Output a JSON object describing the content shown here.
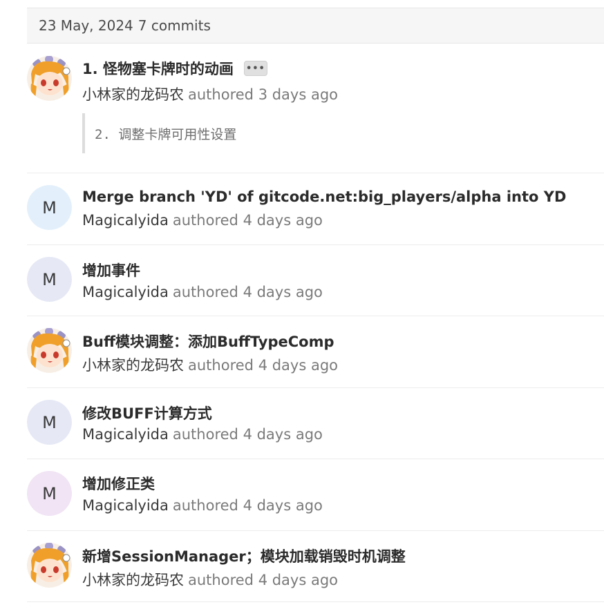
{
  "day_group": {
    "date": "23 May, 2024",
    "count_label": "7 commits"
  },
  "colors": {
    "header_bg": "#f6f6f6",
    "avatar_blue": "#e3f0fb",
    "avatar_indigo": "#e6e9f5",
    "avatar_purple": "#f1e4f4"
  },
  "commits": [
    {
      "title": "1. 怪物塞卡牌时的动画",
      "author": "小林家的龙码农",
      "authored_label": "authored",
      "time": "3 days ago",
      "avatar": "anime-avatar",
      "ellipsis": "•••",
      "description": "2. 调整卡牌可用性设置"
    },
    {
      "title": "Merge branch 'YD' of gitcode.net:big_players/alpha into YD",
      "author": "Magicalyida",
      "authored_label": "authored",
      "time": "4 days ago",
      "avatar_letter": "M"
    },
    {
      "title": "增加事件",
      "author": "Magicalyida",
      "authored_label": "authored",
      "time": "4 days ago",
      "avatar_letter": "M"
    },
    {
      "title": "Buff模块调整：添加BuffTypeComp",
      "author": "小林家的龙码农",
      "authored_label": "authored",
      "time": "4 days ago",
      "avatar": "anime-avatar"
    },
    {
      "title": "修改BUFF计算方式",
      "author": "Magicalyida",
      "authored_label": "authored",
      "time": "4 days ago",
      "avatar_letter": "M"
    },
    {
      "title": "增加修正类",
      "author": "Magicalyida",
      "authored_label": "authored",
      "time": "4 days ago",
      "avatar_letter": "M"
    },
    {
      "title": "新增SessionManager；模块加载销毁时机调整",
      "author": "小林家的龙码农",
      "authored_label": "authored",
      "time": "4 days ago",
      "avatar": "anime-avatar"
    }
  ]
}
